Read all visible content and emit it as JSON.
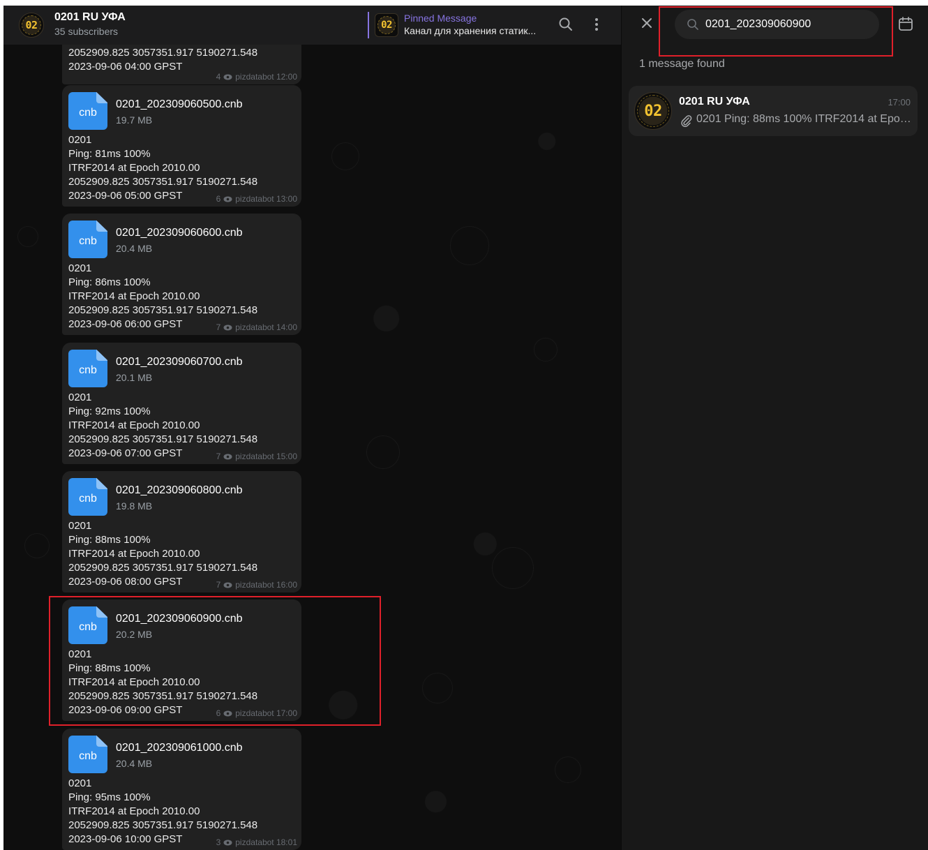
{
  "chat": {
    "title": "0201 RU УФА",
    "subscribers": "35 subscribers",
    "avatar_text": "02",
    "pinned": {
      "label": "Pinned Message",
      "text": "Канал для хранения статик..."
    }
  },
  "first_message": {
    "text": "2052909.825 3057351.917 5190271.548\n2023-09-06 04:00 GPST",
    "views": "4",
    "signature": "pizdatabot 12:00"
  },
  "messages": [
    {
      "file_ext": "cnb",
      "file_name": "0201_202309060500.cnb",
      "file_size": "19.7 MB",
      "text": "0201\nPing: 81ms 100%\nITRF2014 at Epoch 2010.00\n2052909.825 3057351.917 5190271.548\n2023-09-06 05:00 GPST",
      "views": "6",
      "signature": "pizdatabot 13:00"
    },
    {
      "file_ext": "cnb",
      "file_name": "0201_202309060600.cnb",
      "file_size": "20.4 MB",
      "text": "0201\nPing: 86ms 100%\nITRF2014 at Epoch 2010.00\n2052909.825 3057351.917 5190271.548\n2023-09-06 06:00 GPST",
      "views": "7",
      "signature": "pizdatabot 14:00"
    },
    {
      "file_ext": "cnb",
      "file_name": "0201_202309060700.cnb",
      "file_size": "20.1 MB",
      "text": "0201\nPing: 92ms 100%\nITRF2014 at Epoch 2010.00\n2052909.825 3057351.917 5190271.548\n2023-09-06 07:00 GPST",
      "views": "7",
      "signature": "pizdatabot 15:00"
    },
    {
      "file_ext": "cnb",
      "file_name": "0201_202309060800.cnb",
      "file_size": "19.8 MB",
      "text": "0201\nPing: 88ms 100%\nITRF2014 at Epoch 2010.00\n2052909.825 3057351.917 5190271.548\n2023-09-06 08:00 GPST",
      "views": "7",
      "signature": "pizdatabot 16:00"
    },
    {
      "file_ext": "cnb",
      "file_name": "0201_202309060900.cnb",
      "file_size": "20.2 MB",
      "text": "0201\nPing: 88ms 100%\nITRF2014 at Epoch 2010.00\n2052909.825 3057351.917 5190271.548\n2023-09-06 09:00 GPST",
      "views": "6",
      "signature": "pizdatabot 17:00"
    },
    {
      "file_ext": "cnb",
      "file_name": "0201_202309061000.cnb",
      "file_size": "20.4 MB",
      "text": "0201\nPing: 95ms 100%\nITRF2014 at Epoch 2010.00\n2052909.825 3057351.917 5190271.548\n2023-09-06 10:00 GPST",
      "views": "3",
      "signature": "pizdatabot 18:01"
    }
  ],
  "search": {
    "query": "0201_202309060900",
    "results_count": "1 message found",
    "result": {
      "title": "0201 RU УФА",
      "time": "17:00",
      "preview": "0201 Ping: 88ms 100% ITRF2014 at Epoch 2010.00"
    }
  },
  "icons": {
    "header_search": "search-icon",
    "header_menu": "more-vertical-icon",
    "close": "close-icon",
    "calendar": "calendar-icon",
    "views": "eye-icon",
    "attachment": "paperclip-icon"
  },
  "colors": {
    "accent": "#8774e1",
    "file_icon": "#3390ec",
    "highlight_border": "#e0202a",
    "avatar_text": "#f2c230"
  }
}
